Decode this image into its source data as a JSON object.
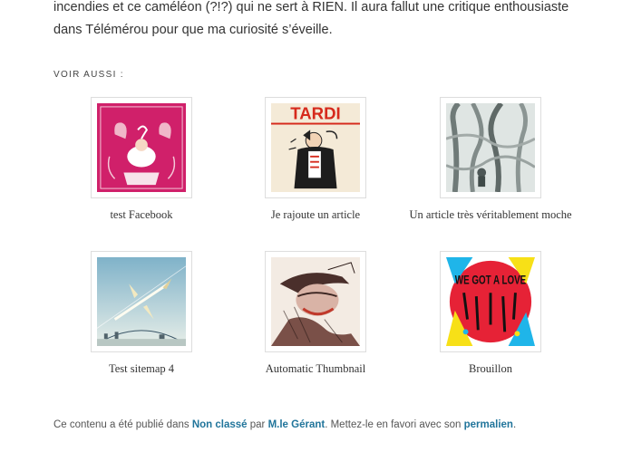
{
  "article": {
    "line1": "incendies et ce caméléon (?!?) qui ne sert à RIEN. Il aura fallut une critique enthousiaste",
    "line2": "dans Télémérou pour que ma curiosité s’éveille."
  },
  "related": {
    "heading": "VOIR AUSSI :",
    "items": [
      {
        "title": "test Facebook",
        "thumb": "magenta-comic-cover"
      },
      {
        "title": "Je rajoute un article",
        "thumb": "tardi-comic-cover",
        "cover_text": "TARDI"
      },
      {
        "title": "Un article très véritablement moche",
        "thumb": "tangled-roots-illustration"
      },
      {
        "title": "Test sitemap 4",
        "thumb": "airplane-poster"
      },
      {
        "title": "Automatic Thumbnail",
        "thumb": "sketch-figure-illustration"
      },
      {
        "title": "Brouillon",
        "thumb": "we-got-a-love-graffiti",
        "cover_text": "WE GOT A LOVE"
      }
    ]
  },
  "footer": {
    "prefix": "Ce contenu a été publié dans ",
    "category": "Non classé",
    "by": " par ",
    "author": "M.le Gérant",
    "bookmark": ". Mettez-le en favori avec son ",
    "permalink": "permalien",
    "end": "."
  },
  "colors": {
    "link": "#21759b",
    "thumb_border": "#dddddd",
    "magenta": "#d0206a",
    "tardi_red": "#d62a1c"
  }
}
